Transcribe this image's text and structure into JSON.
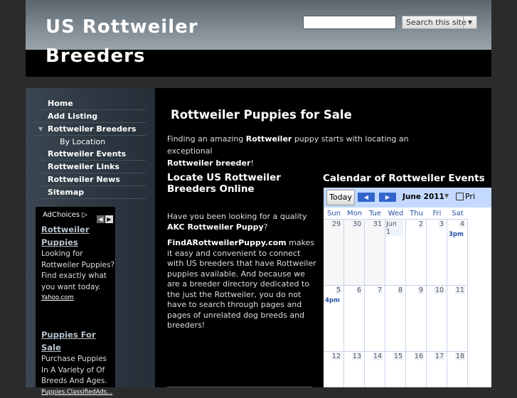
{
  "header": {
    "site_title": "US Rottweiler Breeders",
    "search_input_value": "",
    "search_button_label": "Search this site"
  },
  "sidebar": {
    "nav": [
      {
        "label": "Home"
      },
      {
        "label": "Add Listing"
      },
      {
        "label": "Rottweiler Breeders",
        "expanded": true
      },
      {
        "label": "By Location",
        "sub": true
      },
      {
        "label": "Rottweiler Events"
      },
      {
        "label": "Rottweiler Links"
      },
      {
        "label": "Rottweiler News"
      },
      {
        "label": "Sitemap"
      }
    ],
    "ads": {
      "adchoices_label": "AdChoices",
      "items": [
        {
          "title": "Rottweiler Puppies",
          "text": "Looking for Rottweiler Puppies? Find exactly what you want today.",
          "url": "Yahoo.com"
        },
        {
          "title": "Puppies For Sale",
          "text": "Purchase Puppies In A Variety of Of Breeds And Ages.",
          "url": "Puppies.ClassifiedAds..."
        }
      ]
    }
  },
  "main": {
    "page_title": "Rottweiler Puppies for Sale",
    "intro": {
      "before": "Finding an amazing ",
      "bold1": "Rottweiler",
      "middle": " puppy starts with locating an exceptional ",
      "bold2": "Rottweiler breeder",
      "after": "!"
    },
    "left_column": {
      "title": "Locate US Rottweiler Breeders Online",
      "p1_before": "Have you been looking for a quality ",
      "p1_bold": "AKC Rottweiler Puppy",
      "p1_after": "?",
      "p2_bold": "FindARottweilerPuppy.com",
      "p2_after": " makes it easy and convenient to connect with US breeders that have Rottweiler puppies available. And because we are a breeder directory dedicated to the just the Rottweiler, you do not have to search through pages and pages of unrelated dog breeds and breeders!"
    },
    "calendar": {
      "title": "Calendar of Rottweiler Events",
      "today_label": "Today",
      "prev_icon": "left-arrow-icon",
      "next_icon": "right-arrow-icon",
      "month_label": "June 2011",
      "print_label": "Pri",
      "days": [
        "Sun",
        "Mon",
        "Tue",
        "Wed",
        "Thu",
        "Fri",
        "Sat"
      ],
      "weeks": [
        [
          "29",
          "30",
          "31",
          "Jun 1",
          "2",
          "3",
          "4"
        ],
        [
          "5",
          "6",
          "7",
          "8",
          "9",
          "10",
          "11"
        ],
        [
          "12",
          "13",
          "14",
          "15",
          "16",
          "17",
          "18"
        ]
      ],
      "events": [
        {
          "week": 0,
          "day": 6,
          "label": "3pm"
        },
        {
          "week": 1,
          "day": 0,
          "label": "4pm"
        }
      ]
    }
  }
}
